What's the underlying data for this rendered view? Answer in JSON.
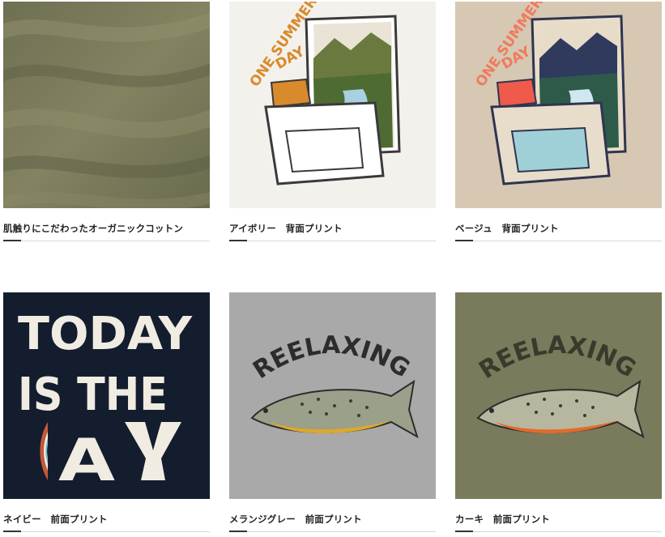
{
  "products": [
    {
      "caption": "肌触りにこだわったオーガニックコットン",
      "image": "fabric-texture",
      "color": "#7a7a5c"
    },
    {
      "caption": "アイボリー　背面プリント",
      "image": "cooler-print",
      "color": "#f3f1ec",
      "print_text": "ONE SUMMER DAY",
      "print_color": "#d98a2c"
    },
    {
      "caption": "ベージュ　背面プリント",
      "image": "cooler-print",
      "color": "#d6c8b2",
      "print_text": "ONE SUMMER DAY",
      "print_color": "#ef7b5e"
    },
    {
      "caption": "ネイビー　前面プリント",
      "image": "today-print",
      "color": "#131d2e",
      "print_lines": [
        "TODAY",
        "IS THE",
        "DAY"
      ]
    },
    {
      "caption": "メランジグレー　前面プリント",
      "image": "trout-print",
      "color": "#a9a9a9",
      "print_text": "REELAXING"
    },
    {
      "caption": "カーキ　前面プリント",
      "image": "trout-print",
      "color": "#7a7a5c",
      "print_text": "REELAXING"
    }
  ]
}
